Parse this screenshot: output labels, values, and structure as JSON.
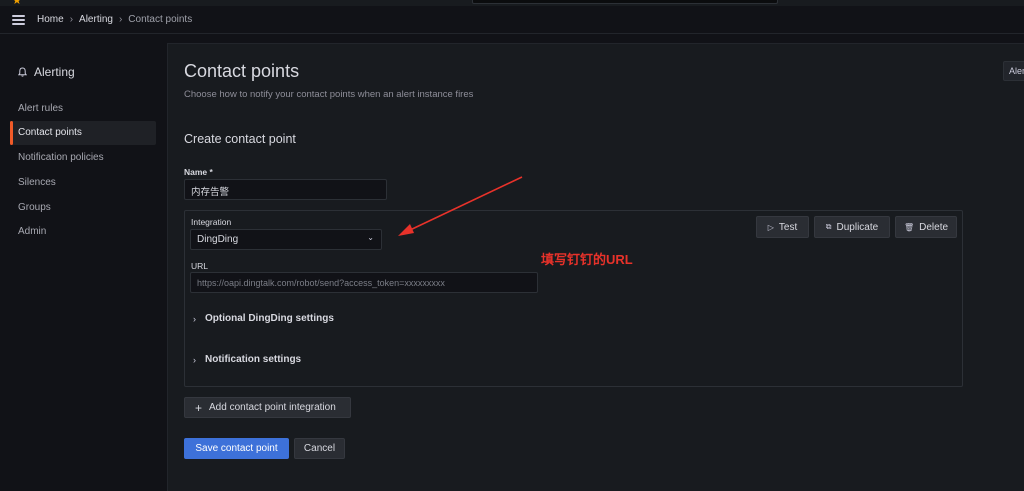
{
  "breadcrumb": {
    "items": [
      "Home",
      "Alerting"
    ],
    "current": "Contact points"
  },
  "sidebar": {
    "title": "Alerting",
    "items": [
      {
        "label": "Alert rules"
      },
      {
        "label": "Contact points",
        "active": true
      },
      {
        "label": "Notification policies"
      },
      {
        "label": "Silences"
      },
      {
        "label": "Groups"
      },
      {
        "label": "Admin"
      }
    ]
  },
  "page": {
    "title": "Contact points",
    "subtitle": "Choose how to notify your contact points when an alert instance fires",
    "corner_button": "Alerting"
  },
  "form": {
    "section_title": "Create contact point",
    "name_label": "Name *",
    "name_value": "内存告警",
    "integration": {
      "label": "Integration",
      "value": "DingDing",
      "url_label": "URL",
      "url_placeholder": "https://oapi.dingtalk.com/robot/send?access_token=xxxxxxxxx",
      "optional_settings": "Optional DingDing settings",
      "notification_settings": "Notification settings",
      "actions": {
        "test": "Test",
        "duplicate": "Duplicate",
        "delete": "Delete"
      }
    },
    "add_integration": "Add contact point integration",
    "save": "Save contact point",
    "cancel": "Cancel"
  },
  "annotation": {
    "text": "填写钉钉的URL",
    "color": "#e8322a"
  },
  "colors": {
    "primary": "#3d71d9",
    "active_indicator": "#f05a28"
  }
}
